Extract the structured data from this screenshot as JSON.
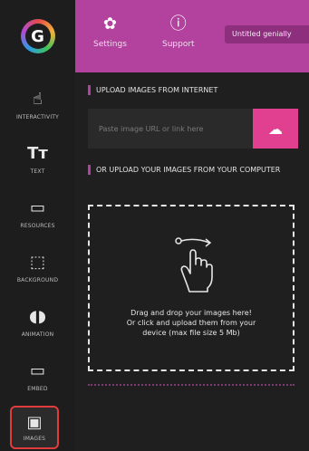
{
  "sidebar": {
    "items": [
      {
        "label": "INTERACTIVITY",
        "icon": "interactivity-icon",
        "glyph": "☝"
      },
      {
        "label": "TEXT",
        "icon": "text-icon",
        "glyph": "Tт"
      },
      {
        "label": "RESOURCES",
        "icon": "resources-icon",
        "glyph": "▭"
      },
      {
        "label": "BACKGROUND",
        "icon": "background-icon",
        "glyph": "⬚"
      },
      {
        "label": "ANIMATION",
        "icon": "animation-icon",
        "glyph": "◖◗"
      },
      {
        "label": "EMBED",
        "icon": "embed-icon",
        "glyph": "▭"
      },
      {
        "label": "IMAGES",
        "icon": "images-icon",
        "glyph": "▣"
      }
    ]
  },
  "topbar": {
    "settings_label": "Settings",
    "support_label": "Support",
    "title": "Untitled genially"
  },
  "panel": {
    "upload_internet_title": "UPLOAD IMAGES FROM INTERNET",
    "url_placeholder": "Paste image URL or link here",
    "upload_computer_title": "OR UPLOAD YOUR IMAGES FROM YOUR COMPUTER",
    "drop_line1": "Drag and drop your images here!",
    "drop_line2": "Or click and upload them from your",
    "drop_line3": "device (max file size 5 Mb)"
  },
  "colors": {
    "accent": "#b3419e",
    "upload_button": "#e0408f",
    "active_outline": "#e23b3b"
  }
}
